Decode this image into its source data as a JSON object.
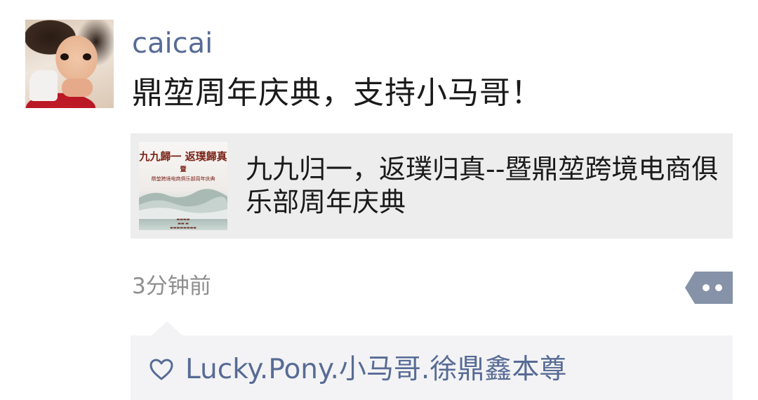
{
  "post": {
    "username": "caicai",
    "text": "鼎堃周年庆典，支持小马哥！",
    "link_card": {
      "title": "九九归一，返璞归真--暨鼎堃跨境电商俱乐部周年庆典",
      "thumbnail": {
        "heading": "九九歸一 返璞歸真",
        "connector": "暨",
        "subheading": "鼎堃跨境电商俱乐部周年庆典"
      }
    },
    "timestamp": "3分钟前",
    "more_icon": "ellipsis-icon"
  },
  "likes": {
    "icon": "heart-outline-icon",
    "names": "Lucky.Pony.小马哥.徐鼎鑫本尊"
  },
  "colors": {
    "name_link": "#576b95",
    "text": "#1a1a1a",
    "meta": "#8e8e8e",
    "card_bg": "#ededed",
    "comment_bg": "#f3f3f5"
  }
}
